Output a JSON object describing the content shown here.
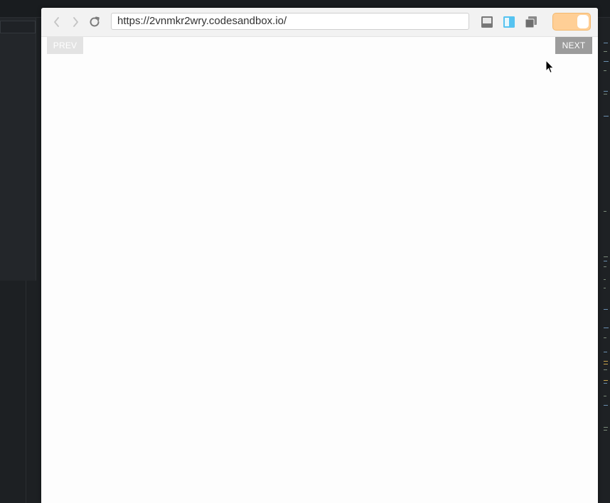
{
  "browser": {
    "url": "https://2vnmkr2wry.codesandbox.io/",
    "nav": {
      "back_icon": "chevron-left-icon",
      "forward_icon": "chevron-right-icon",
      "refresh_icon": "refresh-icon"
    },
    "layout_icons": [
      "console-panel-icon",
      "side-by-side-icon",
      "new-window-icon"
    ],
    "toggle": {
      "state": "on",
      "color": "#ffcf96"
    }
  },
  "page": {
    "prev_label": "PREV",
    "next_label": "NEXT"
  },
  "colors": {
    "editor_background": "#1d2023",
    "accent_blue": "#56c3f0",
    "toggle_orange": "#ffcf96"
  }
}
